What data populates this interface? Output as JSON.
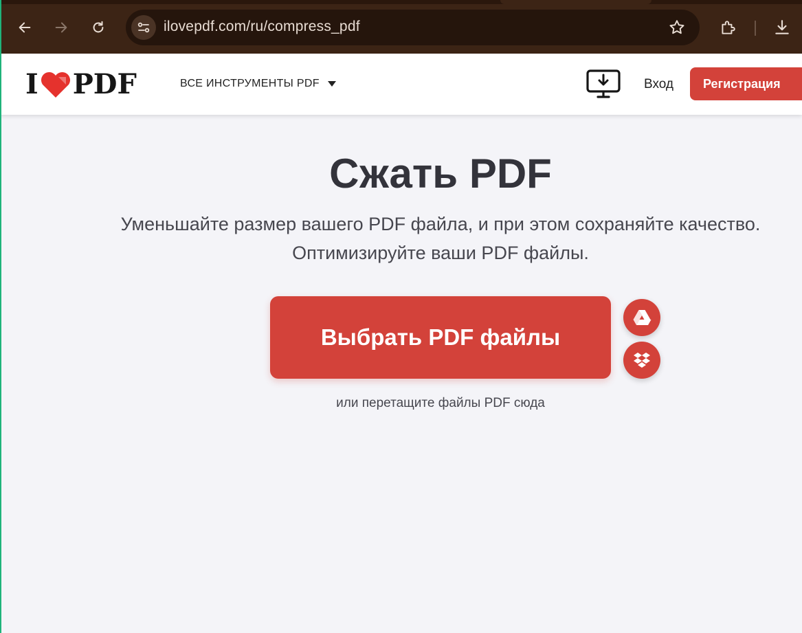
{
  "browser": {
    "url": "ilovepdf.com/ru/compress_pdf"
  },
  "header": {
    "logo": {
      "left": "I",
      "right": "PDF"
    },
    "tools_menu_label": "ВСЕ ИНСТРУМЕНТЫ PDF",
    "login_label": "Вход",
    "signup_label": "Регистрация"
  },
  "main": {
    "title": "Сжать PDF",
    "subtitle_line1": "Уменьшайте размер вашего PDF файла, и при этом сохраняйте качество.",
    "subtitle_line2": "Оптимизируйте ваши PDF файлы.",
    "select_button_label": "Выбрать PDF файлы",
    "drop_hint": "или перетащите файлы PDF сюда"
  },
  "colors": {
    "brand_red": "#d3423a",
    "chrome_bg": "#3c2415",
    "page_bg": "#f4f4f8"
  },
  "icons": [
    "back-arrow-icon",
    "forward-arrow-icon",
    "reload-icon",
    "site-settings-icon",
    "bookmark-star-icon",
    "extensions-icon",
    "download-icon",
    "heart-logo-icon",
    "desktop-download-icon",
    "google-drive-icon",
    "dropbox-icon"
  ]
}
